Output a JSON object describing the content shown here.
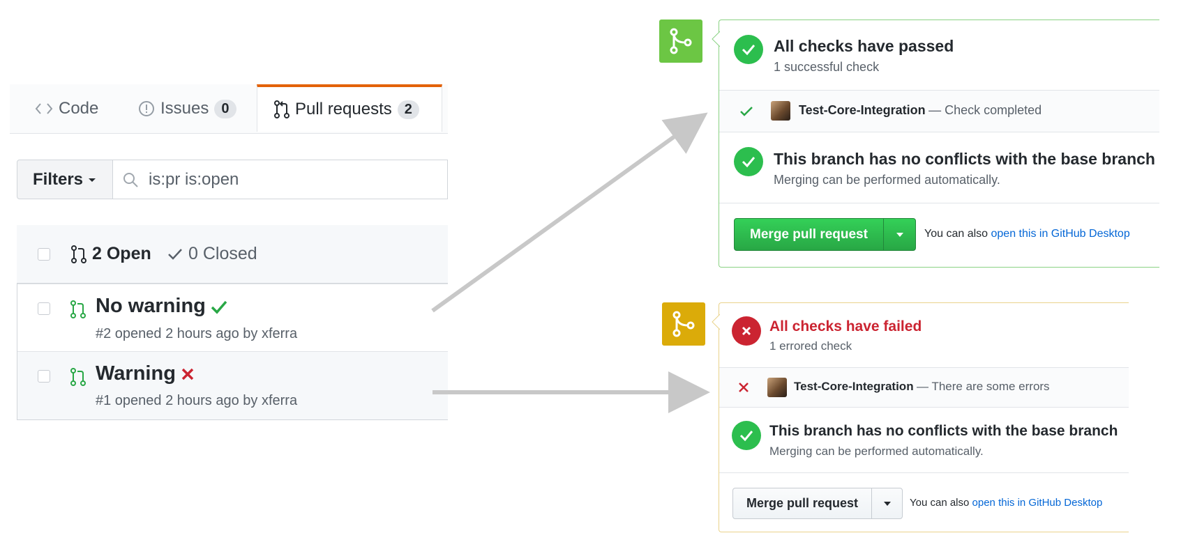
{
  "tabs": {
    "code": "Code",
    "issues": "Issues",
    "issues_count": "0",
    "pull_requests": "Pull requests",
    "pull_requests_count": "2"
  },
  "filters": {
    "label": "Filters",
    "search_value": "is:pr is:open"
  },
  "list": {
    "open_label": "2 Open",
    "closed_label": "0 Closed",
    "items": [
      {
        "title": "No warning",
        "status": "success",
        "meta": "#2 opened 2 hours ago by xferra"
      },
      {
        "title": "Warning",
        "status": "failure",
        "meta": "#1 opened 2 hours ago by xferra"
      }
    ]
  },
  "panels": [
    {
      "theme": "success",
      "accent": "#6cc644",
      "checks_title": "All checks have passed",
      "checks_sub": "1 successful check",
      "context_name": "Test-Core-Integration",
      "context_desc": "— Check completed",
      "conflict_title": "This branch has no conflicts with the base branch",
      "conflict_sub": "Merging can be performed automatically.",
      "merge_label": "Merge pull request",
      "also_text": "You can also",
      "also_link": "open this in GitHub Desktop"
    },
    {
      "theme": "failure",
      "accent": "#dbab09",
      "checks_title": "All checks have failed",
      "checks_sub": "1 errored check",
      "context_name": "Test-Core-Integration",
      "context_desc": "— There are some errors",
      "conflict_title": "This branch has no conflicts with the base branch",
      "conflict_sub": "Merging can be performed automatically.",
      "merge_label": "Merge pull request",
      "also_text": "You can also",
      "also_link": "open this in GitHub Desktop"
    }
  ],
  "colors": {
    "success_green": "#2cbe4e",
    "failure_red": "#cb2431",
    "link_blue": "#0366d6",
    "tab_accent": "#e36209"
  }
}
